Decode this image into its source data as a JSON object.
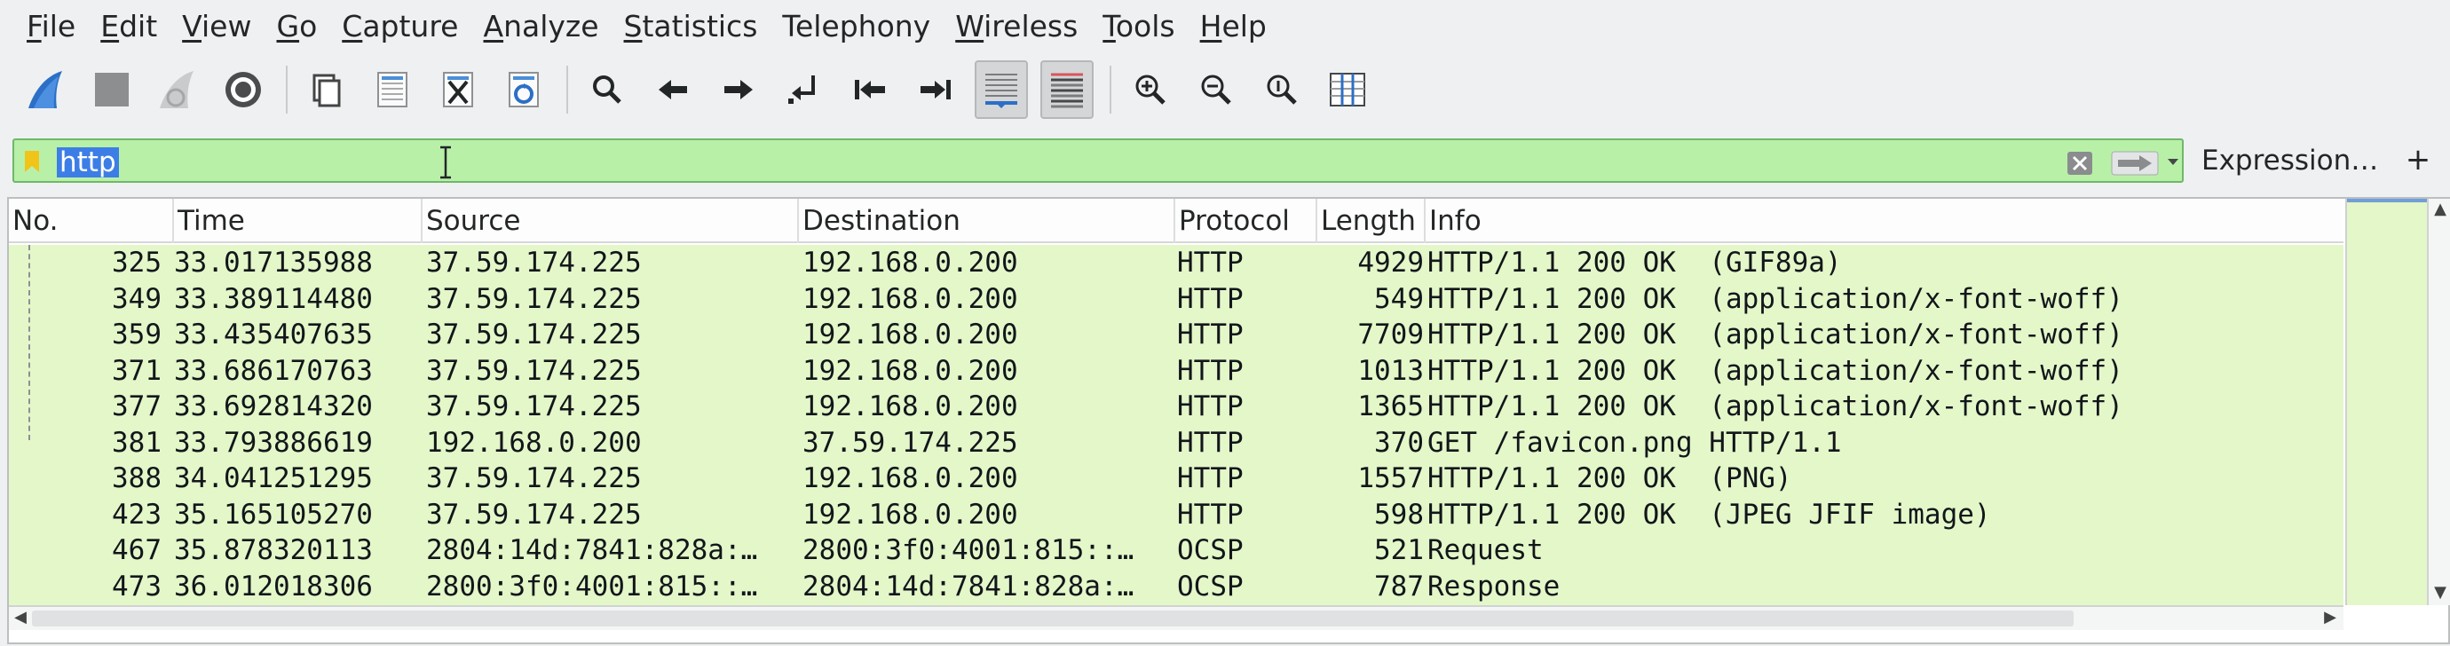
{
  "menu": [
    {
      "mnemonic": "F",
      "rest": "ile"
    },
    {
      "mnemonic": "E",
      "rest": "dit"
    },
    {
      "mnemonic": "V",
      "rest": "iew"
    },
    {
      "mnemonic": "G",
      "rest": "o"
    },
    {
      "mnemonic": "C",
      "rest": "apture"
    },
    {
      "mnemonic": "A",
      "rest": "nalyze"
    },
    {
      "mnemonic": "S",
      "rest": "tatistics"
    },
    {
      "mnemonic": "",
      "rest": "Telephony"
    },
    {
      "mnemonic": "W",
      "rest": "ireless"
    },
    {
      "mnemonic": "T",
      "rest": "ools"
    },
    {
      "mnemonic": "H",
      "rest": "elp"
    }
  ],
  "toolbar": {
    "icons": [
      "shark-fin-start-icon",
      "stop-square-icon",
      "restart-fin-icon",
      "capture-options-gear-icon",
      "open-folder-icon",
      "file-icon",
      "close-file-icon",
      "reload-file-icon",
      "find-packet-icon",
      "go-back-icon",
      "go-forward-icon",
      "go-to-packet-icon",
      "first-packet-icon",
      "last-packet-icon",
      "auto-scroll-icon",
      "colorize-icon",
      "zoom-in-icon",
      "zoom-out-icon",
      "zoom-normal-icon",
      "resize-columns-icon"
    ],
    "colors": {
      "fin": "#2c6fc6",
      "stop": "#8c8e90",
      "disabled": "#b6b8ba"
    }
  },
  "filter": {
    "value": "http",
    "expression_label": "Expression…",
    "plus_label": "+",
    "color_valid": "#b8f0a8"
  },
  "columns": [
    "No.",
    "Time",
    "Source",
    "Destination",
    "Protocol",
    "Length",
    "Info"
  ],
  "packets": [
    {
      "no": "325",
      "time": "33.017135988",
      "src": "37.59.174.225",
      "dst": "192.168.0.200",
      "proto": "HTTP",
      "len": "4929",
      "info": "HTTP/1.1 200 OK  (GIF89a)"
    },
    {
      "no": "349",
      "time": "33.389114480",
      "src": "37.59.174.225",
      "dst": "192.168.0.200",
      "proto": "HTTP",
      "len": "549",
      "info": "HTTP/1.1 200 OK  (application/x-font-woff)"
    },
    {
      "no": "359",
      "time": "33.435407635",
      "src": "37.59.174.225",
      "dst": "192.168.0.200",
      "proto": "HTTP",
      "len": "7709",
      "info": "HTTP/1.1 200 OK  (application/x-font-woff)"
    },
    {
      "no": "371",
      "time": "33.686170763",
      "src": "37.59.174.225",
      "dst": "192.168.0.200",
      "proto": "HTTP",
      "len": "1013",
      "info": "HTTP/1.1 200 OK  (application/x-font-woff)"
    },
    {
      "no": "377",
      "time": "33.692814320",
      "src": "37.59.174.225",
      "dst": "192.168.0.200",
      "proto": "HTTP",
      "len": "1365",
      "info": "HTTP/1.1 200 OK  (application/x-font-woff)"
    },
    {
      "no": "381",
      "time": "33.793886619",
      "src": "192.168.0.200",
      "dst": "37.59.174.225",
      "proto": "HTTP",
      "len": "370",
      "info": "GET /favicon.png HTTP/1.1"
    },
    {
      "no": "388",
      "time": "34.041251295",
      "src": "37.59.174.225",
      "dst": "192.168.0.200",
      "proto": "HTTP",
      "len": "1557",
      "info": "HTTP/1.1 200 OK  (PNG)"
    },
    {
      "no": "423",
      "time": "35.165105270",
      "src": "37.59.174.225",
      "dst": "192.168.0.200",
      "proto": "HTTP",
      "len": "598",
      "info": "HTTP/1.1 200 OK  (JPEG JFIF image)"
    },
    {
      "no": "467",
      "time": "35.878320113",
      "src": "2804:14d:7841:828a:…",
      "dst": "2800:3f0:4001:815::…",
      "proto": "OCSP",
      "len": "521",
      "info": "Request"
    },
    {
      "no": "473",
      "time": "36.012018306",
      "src": "2800:3f0:4001:815::…",
      "dst": "2804:14d:7841:828a:…",
      "proto": "OCSP",
      "len": "787",
      "info": "Response"
    }
  ],
  "row_color": "#e4f7c9"
}
